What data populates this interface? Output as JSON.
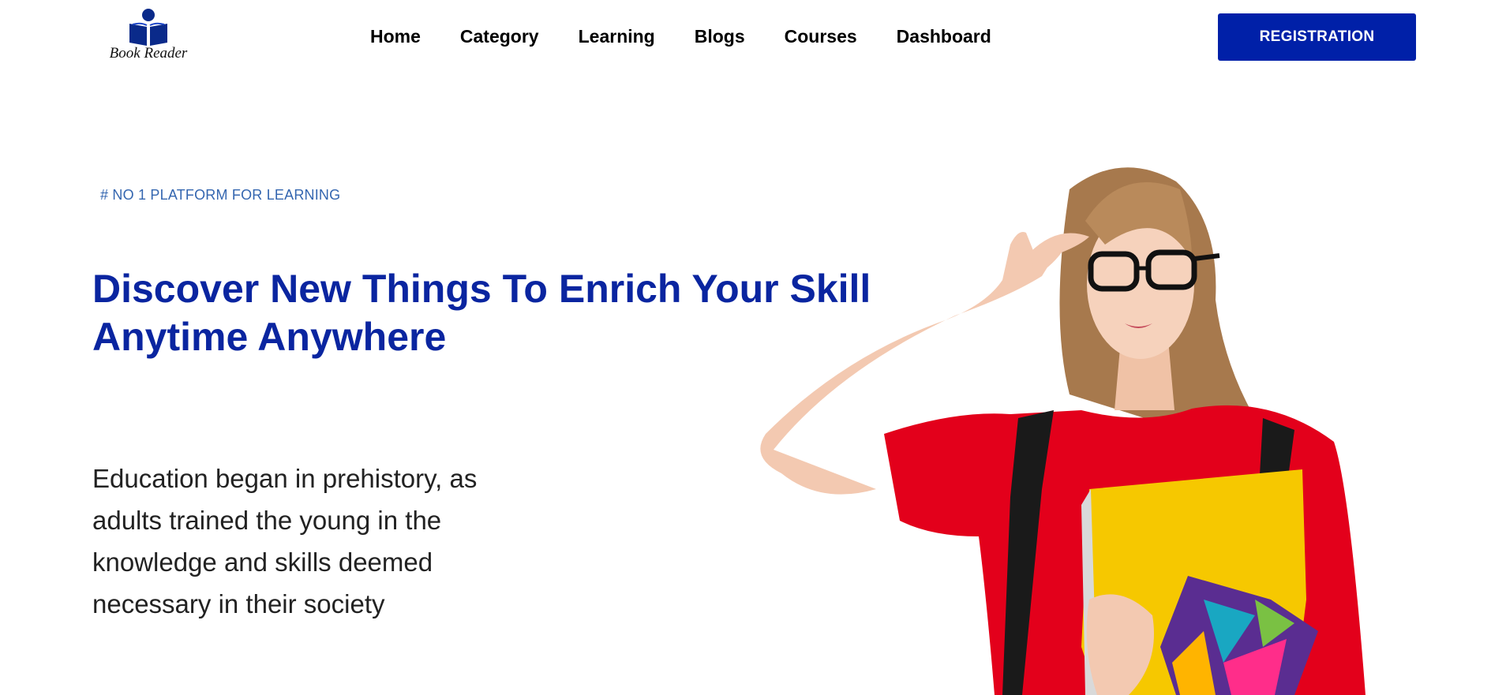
{
  "brand": {
    "name": "Book Reader",
    "icon": "book-reader-icon",
    "color": "#0a2a8a"
  },
  "nav": {
    "items": [
      {
        "label": "Home"
      },
      {
        "label": "Category"
      },
      {
        "label": "Learning"
      },
      {
        "label": "Blogs"
      },
      {
        "label": "Courses"
      },
      {
        "label": "Dashboard"
      }
    ]
  },
  "header": {
    "registration_label": "REGISTRATION",
    "accent": "#0020a8"
  },
  "hero": {
    "tagline": "# NO 1 PLATFORM FOR LEARNING",
    "headline": "Discover New Things To Enrich Your Skill Anytime Anywhere",
    "description": "Education began in prehistory, as adults trained the young in the knowledge and skills deemed necessary in their society",
    "image": "student-with-glasses-and-folders-photo"
  }
}
